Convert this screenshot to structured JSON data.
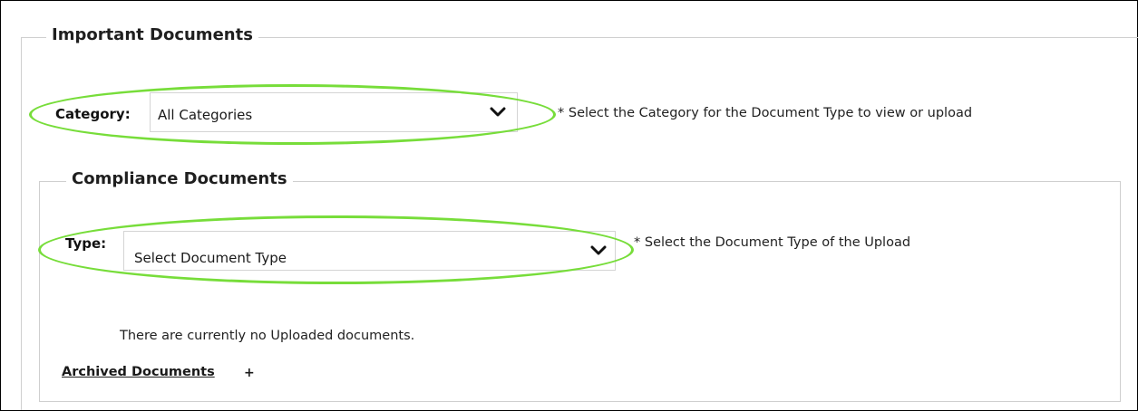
{
  "important_documents": {
    "legend": "Important Documents",
    "category": {
      "label": "Category:",
      "selected_value": "All Categories",
      "help_text": "* Select the Category for the Document Type to view or upload"
    }
  },
  "compliance_documents": {
    "legend": "Compliance Documents",
    "type": {
      "label": "Type:",
      "selected_value": "Select Document Type",
      "help_text": "* Select the Document Type of the Upload"
    },
    "empty_message": "There are currently no Uploaded documents.",
    "archived_link": "Archived Documents",
    "archived_toggle": "+"
  },
  "colors": {
    "highlight": "#77dd3a",
    "border": "#cfcfcf"
  },
  "icons": {
    "dropdown": "chevron-down-icon",
    "expand": "plus-icon"
  }
}
